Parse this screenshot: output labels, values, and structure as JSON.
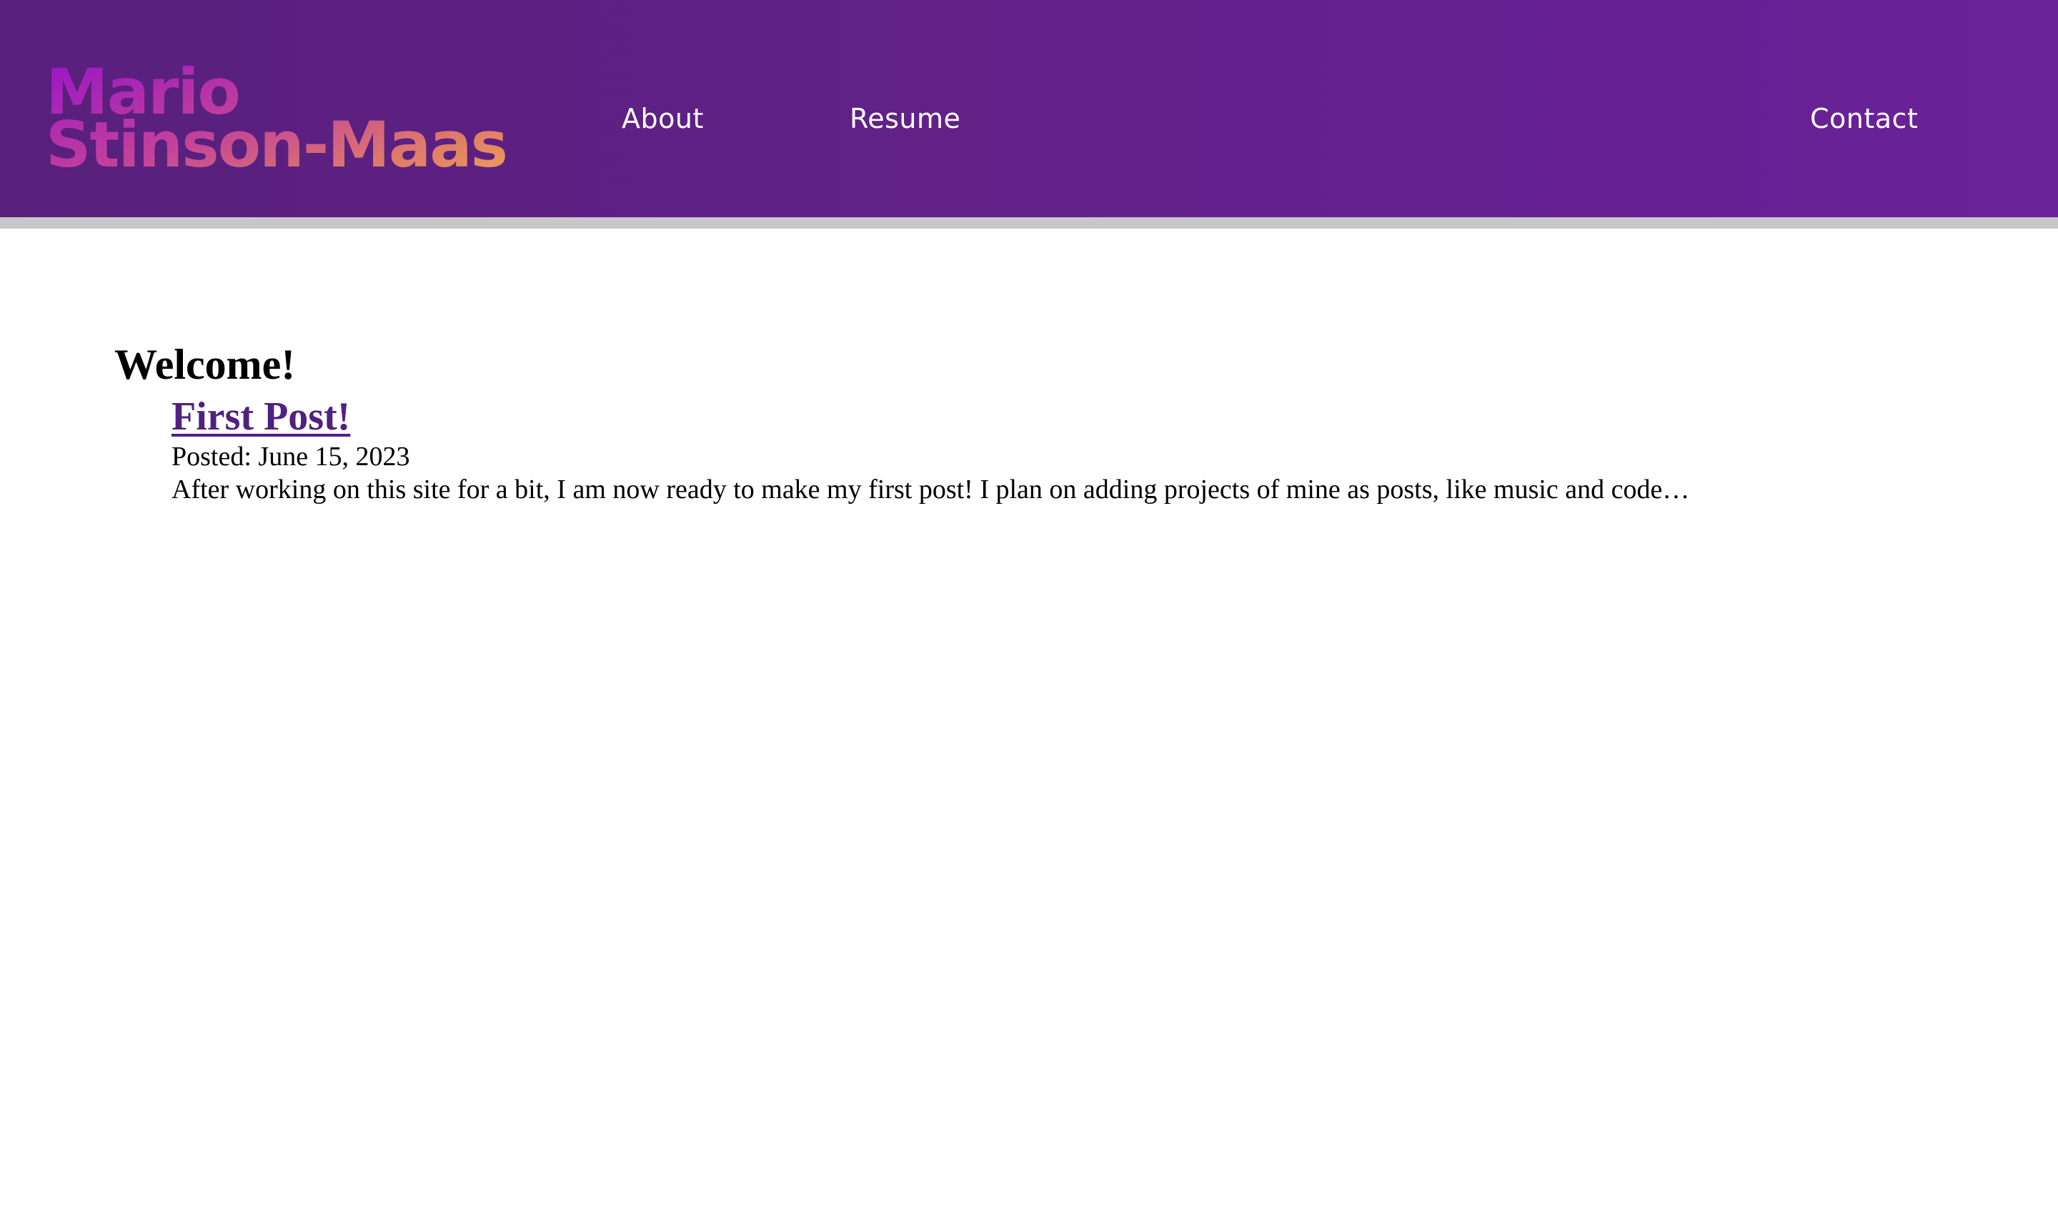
{
  "header": {
    "logo_line1": "Mario",
    "logo_line2": "Stinson-Maas",
    "nav": {
      "about": "About",
      "resume": "Resume",
      "contact": "Contact"
    },
    "colors": {
      "header_bg": "#62218a",
      "logo_gradient_start": "#9b16c4",
      "logo_gradient_end": "#eda057",
      "rule": "#c9c6cb"
    }
  },
  "main": {
    "heading": "Welcome!",
    "posts": [
      {
        "title": "First Post!",
        "meta": "Posted: June 15, 2023",
        "excerpt": "After working on this site for a bit, I am now ready to make my first post! I plan on adding projects of mine as posts, like music and code…"
      }
    ],
    "colors": {
      "post_link": "#51217f"
    }
  }
}
